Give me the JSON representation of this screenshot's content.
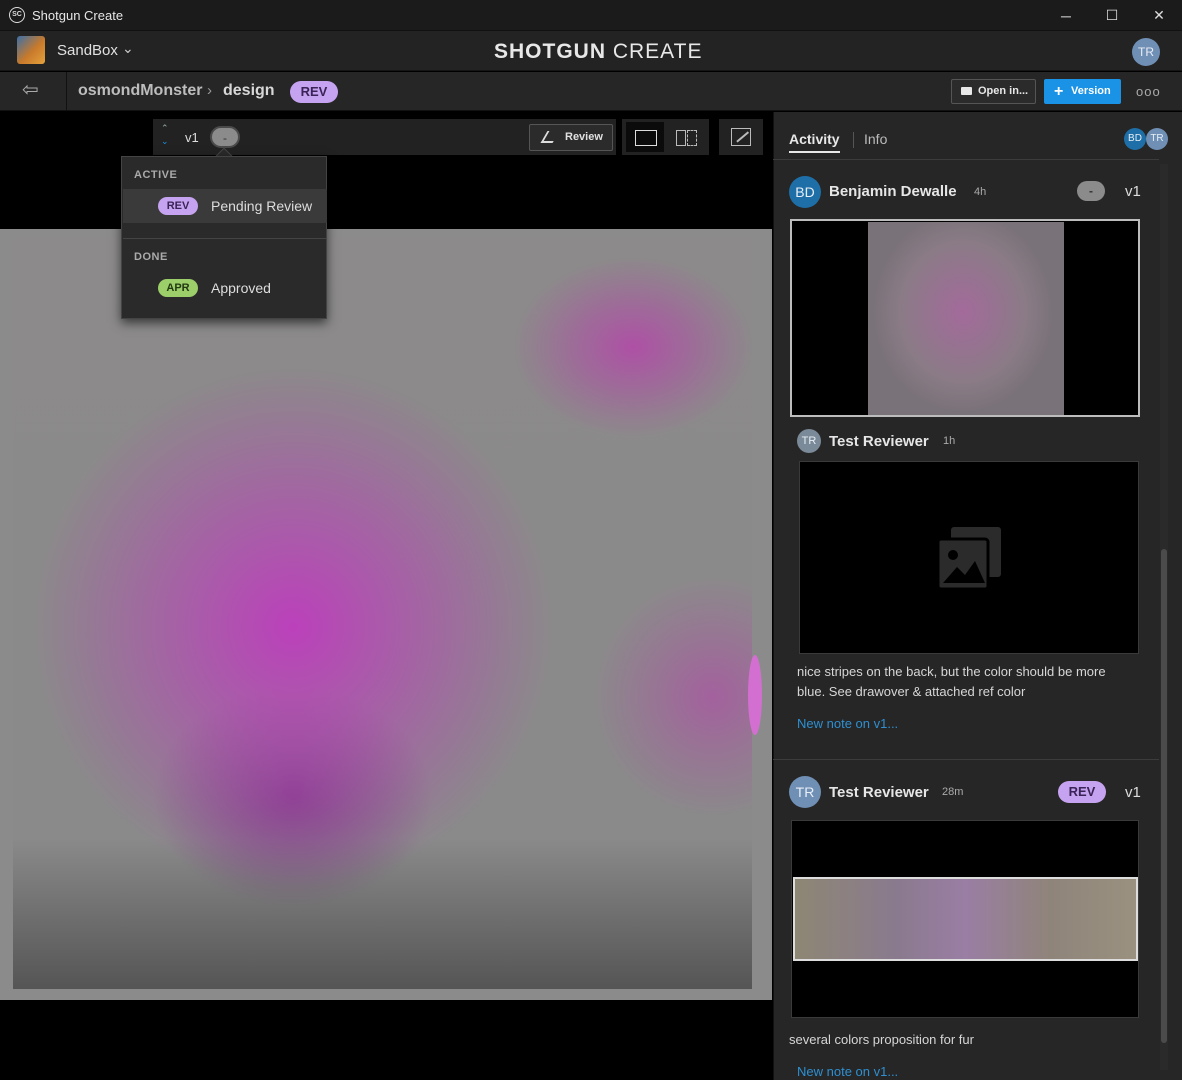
{
  "window": {
    "title": "Shotgun Create",
    "logo_text": "SC",
    "minimize": "─",
    "maximize": "☐",
    "close": "✕"
  },
  "header": {
    "project": "SandBox",
    "project_chevron": "⌄",
    "brand_bold": "SHOTGUN",
    "brand_light": " CREATE",
    "user_initials": "TR"
  },
  "breadcrumb": {
    "back_icon": "⇦",
    "entity": "osmondMonster",
    "separator": "›",
    "task": "design",
    "status": "REV",
    "open_in_label": "Open in...",
    "version_label": "Version",
    "version_plus": "+",
    "more": "ooo"
  },
  "viewer": {
    "version": "v1",
    "status_dot": "-",
    "review_label": "Review"
  },
  "status_menu": {
    "sections": [
      {
        "title": "ACTIVE",
        "items": [
          {
            "code": "REV",
            "label": "Pending Review"
          }
        ]
      },
      {
        "title": "DONE",
        "items": [
          {
            "code": "APR",
            "label": "Approved"
          }
        ]
      }
    ]
  },
  "panel": {
    "tabs": [
      {
        "label": "Activity"
      },
      {
        "label": "Info"
      }
    ],
    "participants": [
      "BD",
      "TR"
    ],
    "feed": [
      {
        "initials": "BD",
        "author": "Benjamin Dewalle",
        "time": "4h",
        "status": "-",
        "version": "v1"
      },
      {
        "initials": "TR",
        "author": "Test Reviewer",
        "time": "1h",
        "text": "nice stripes on the back, but the color should be more blue. See drawover & attached ref color",
        "link": "New note on v1..."
      },
      {
        "initials": "TR",
        "author": "Test Reviewer",
        "time": "28m",
        "status": "REV",
        "version": "v1",
        "text": "several colors proposition for fur",
        "link": "New note on v1..."
      }
    ]
  },
  "colors": {
    "accent": "#1a93e6",
    "rev": "#c6a3f0",
    "apr": "#9ccf6a",
    "link": "#2e8fd1"
  }
}
